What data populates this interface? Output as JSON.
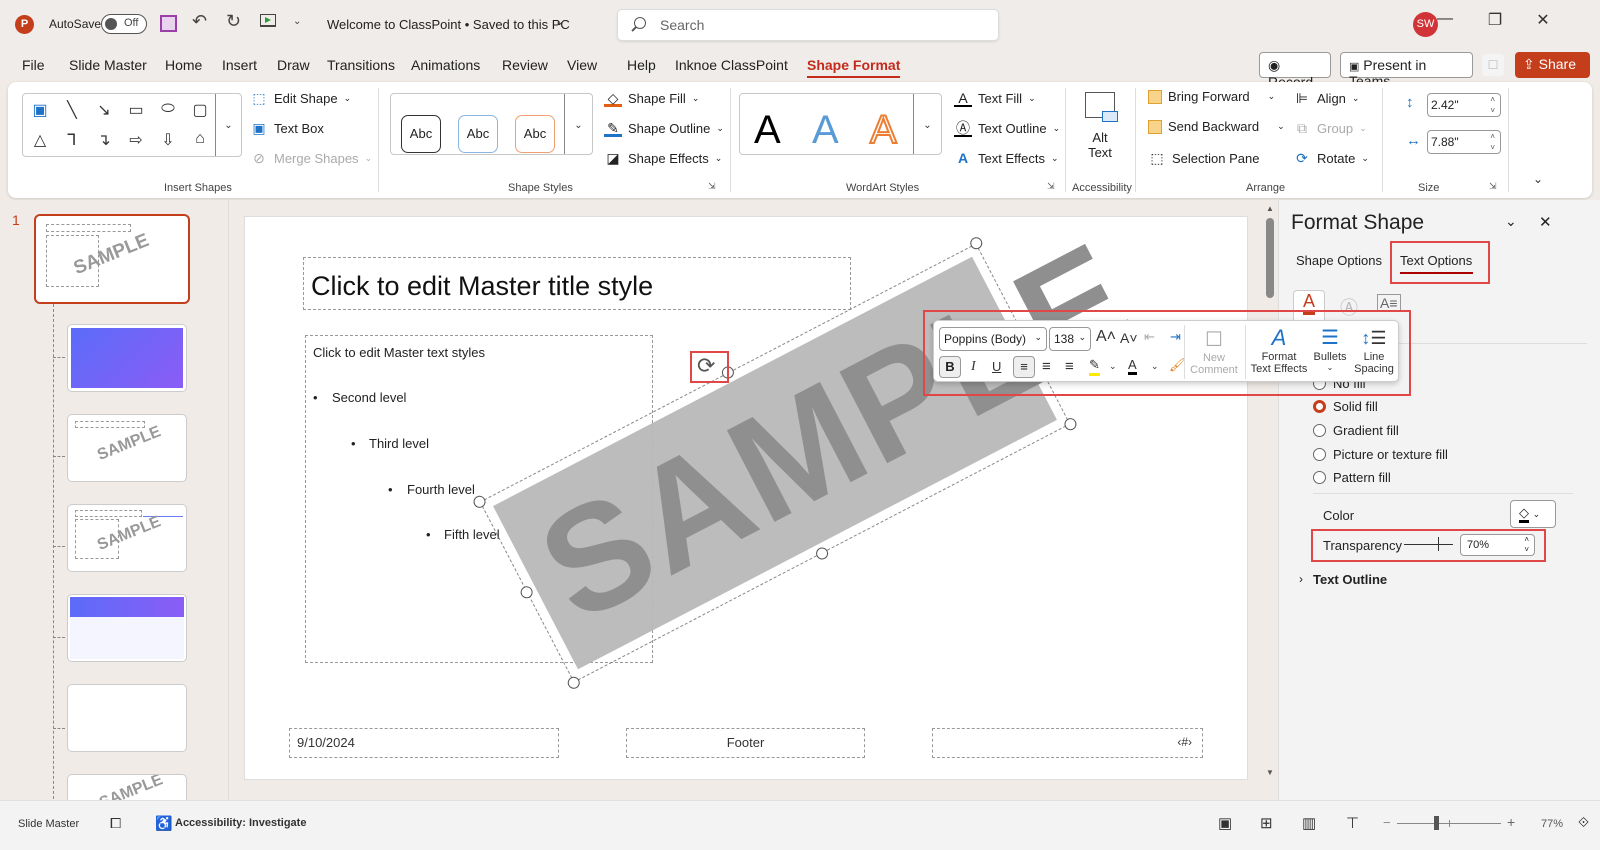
{
  "titlebar": {
    "autosave_label": "AutoSave",
    "autosave_state": "Off",
    "document_title": "Welcome to ClassPoint • Saved to this PC",
    "search_placeholder": "Search",
    "user_initials": "SW",
    "icons": [
      "powerpoint-logo-icon",
      "save-icon",
      "undo-icon",
      "redo-icon",
      "present-from-start-icon",
      "customize-toolbar-icon",
      "minimize-icon",
      "restore-icon",
      "close-icon"
    ]
  },
  "menu": {
    "tabs": [
      "File",
      "Slide Master",
      "Home",
      "Insert",
      "Draw",
      "Transitions",
      "Animations",
      "Review",
      "View",
      "Help",
      "Inknoe ClassPoint",
      "Shape Format"
    ],
    "active_tab": "Shape Format",
    "record_label": "Record",
    "present_teams_label": "Present in Teams",
    "share_label": "Share"
  },
  "ribbon": {
    "insert_shapes": {
      "label": "Insert Shapes",
      "edit_shape": "Edit Shape",
      "text_box": "Text Box",
      "merge_shapes": "Merge Shapes"
    },
    "shape_styles": {
      "label": "Shape Styles",
      "swatches": [
        "Abc",
        "Abc",
        "Abc"
      ],
      "shape_fill": "Shape Fill",
      "shape_outline": "Shape Outline",
      "shape_effects": "Shape Effects"
    },
    "wordart_styles": {
      "label": "WordArt Styles",
      "swatches": [
        "A",
        "A",
        "A"
      ],
      "text_fill": "Text Fill",
      "text_outline": "Text Outline",
      "text_effects": "Text Effects"
    },
    "accessibility": {
      "label": "Accessibility",
      "alt_text_line1": "Alt",
      "alt_text_line2": "Text"
    },
    "arrange": {
      "label": "Arrange",
      "bring_forward": "Bring Forward",
      "send_backward": "Send Backward",
      "selection_pane": "Selection Pane",
      "align": "Align",
      "group": "Group",
      "rotate": "Rotate"
    },
    "size": {
      "label": "Size",
      "height": "2.42\"",
      "width": "7.88\""
    }
  },
  "thumbnails": {
    "master_number": "1",
    "sample_text": "SAMPLE",
    "colors": {
      "gradient_start": "#5b6cf8",
      "gradient_end": "#8b5cf6"
    }
  },
  "slide": {
    "title": "Click to edit Master title style",
    "body_levels": [
      "Click to edit Master text styles",
      "Second level",
      "Third level",
      "Fourth level",
      "Fifth level"
    ],
    "date": "9/10/2024",
    "footer": "Footer",
    "page_number": "‹#›",
    "watermark": "SAMPLE"
  },
  "floatbar": {
    "font": "Poppins (Body)",
    "size": "138",
    "new_comment_line1": "New",
    "new_comment_line2": "Comment",
    "format_text_effects_line1": "Format",
    "format_text_effects_line2": "Text Effects",
    "bullets": "Bullets",
    "line_spacing_line1": "Line",
    "line_spacing_line2": "Spacing",
    "bold": "B",
    "italic": "I",
    "underline": "U"
  },
  "pane": {
    "title": "Format Shape",
    "tabs": [
      "Shape Options",
      "Text Options"
    ],
    "active_tab": "Text Options",
    "fill_options": [
      "No fill",
      "Solid fill",
      "Gradient fill",
      "Picture or texture fill",
      "Pattern fill"
    ],
    "selected_fill": "Solid fill",
    "color_label": "Color",
    "transparency_label": "Transparency",
    "transparency_value": "70%",
    "transparency_fraction": 0.7,
    "text_outline": "Text Outline"
  },
  "status": {
    "view": "Slide Master",
    "accessibility": "Accessibility: Investigate",
    "zoom": "77%",
    "zoom_fraction": 0.77
  },
  "colors": {
    "accent": "#c43e1c",
    "highlight_box": "#e04848",
    "share_button": "#c43e1c",
    "watermark_fill": "#b8b8b8",
    "watermark_text": "#8f8f8f"
  }
}
